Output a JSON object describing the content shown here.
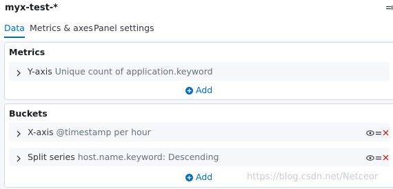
{
  "index_pattern": "myx-test-*",
  "tabs": [
    {
      "label": "Data",
      "selected": true
    },
    {
      "label": "Metrics & axes",
      "selected": false
    },
    {
      "label": "Panel settings",
      "selected": false
    }
  ],
  "metrics": {
    "title": "Metrics",
    "items": [
      {
        "label": "Y-axis",
        "description": "Unique count of application.keyword"
      }
    ],
    "add_label": "Add"
  },
  "buckets": {
    "title": "Buckets",
    "items": [
      {
        "label": "X-axis",
        "description": "@timestamp per hour"
      },
      {
        "label": "Split series",
        "description": "host.name.keyword: Descending"
      }
    ],
    "add_label": "Add"
  },
  "watermark": "https://blog.csdn.net/Netceor",
  "colors": {
    "accent": "#006bb8",
    "danger": "#bd271e",
    "panel_bg": "#ffffff",
    "page_bg": "#f5f7fa"
  }
}
